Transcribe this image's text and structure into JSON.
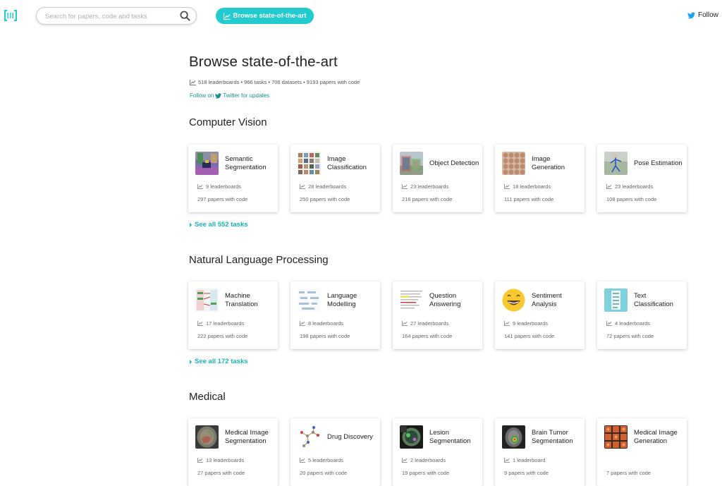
{
  "navbar": {
    "search_placeholder": "Search for papers, code and tasks",
    "browse_label": "Browse state-of-the-art",
    "follow_label": "Follow"
  },
  "header": {
    "title": "Browse state-of-the-art",
    "stats": "518 leaderboards • 966 tasks • 706 datasets • 9193 papers with code",
    "follow_prefix": "Follow on",
    "follow_link": "Twitter for updates"
  },
  "colors": {
    "accent": "#21cbce",
    "link": "#15908f"
  },
  "sections": [
    {
      "title": "Computer Vision",
      "see_all": "See all 552 tasks",
      "cards": [
        {
          "title": "Semantic Segmentation",
          "leaderboards": "9 leaderboards",
          "papers": "297 papers with code",
          "icon": "semantic-segmentation-thumbnail"
        },
        {
          "title": "Image Classification",
          "leaderboards": "28 leaderboards",
          "papers": "250 papers with code",
          "icon": "image-classification-thumbnail"
        },
        {
          "title": "Object Detection",
          "leaderboards": "23 leaderboards",
          "papers": "216 papers with code",
          "icon": "object-detection-thumbnail"
        },
        {
          "title": "Image Generation",
          "leaderboards": "18 leaderboards",
          "papers": "111 papers with code",
          "icon": "image-generation-thumbnail"
        },
        {
          "title": "Pose Estimation",
          "leaderboards": "23 leaderboards",
          "papers": "108 papers with code",
          "icon": "pose-estimation-thumbnail"
        }
      ]
    },
    {
      "title": "Natural Language Processing",
      "see_all": "See all 172 tasks",
      "cards": [
        {
          "title": "Machine Translation",
          "leaderboards": "17 leaderboards",
          "papers": "222 papers with code",
          "icon": "machine-translation-thumbnail"
        },
        {
          "title": "Language Modelling",
          "leaderboards": "8 leaderboards",
          "papers": "198 papers with code",
          "icon": "language-modelling-thumbnail"
        },
        {
          "title": "Question Answering",
          "leaderboards": "27 leaderboards",
          "papers": "164 papers with code",
          "icon": "question-answering-thumbnail"
        },
        {
          "title": "Sentiment Analysis",
          "leaderboards": "9 leaderboards",
          "papers": "141 papers with code",
          "icon": "smiley-emoji-thumbnail"
        },
        {
          "title": "Text Classification",
          "leaderboards": "4 leaderboards",
          "papers": "72 papers with code",
          "icon": "text-classification-thumbnail"
        }
      ]
    },
    {
      "title": "Medical",
      "cards": [
        {
          "title": "Medical Image Segmentation",
          "leaderboards": "13 leaderboards",
          "papers": "27 papers with code",
          "icon": "brain-scan-thumbnail"
        },
        {
          "title": "Drug Discovery",
          "leaderboards": "5 leaderboards",
          "papers": "20 papers with code",
          "icon": "molecule-thumbnail"
        },
        {
          "title": "Lesion Segmentation",
          "leaderboards": "2 leaderboards",
          "papers": "19 papers with code",
          "icon": "lesion-scan-thumbnail"
        },
        {
          "title": "Brain Tumor Segmentation",
          "leaderboards": "1 leaderboard",
          "papers": "9 papers with code",
          "icon": "brain-tumor-thumbnail"
        },
        {
          "title": "Medical Image Generation",
          "leaderboards": "",
          "papers": "7 papers with code",
          "icon": "medical-generation-thumbnail"
        }
      ]
    }
  ]
}
